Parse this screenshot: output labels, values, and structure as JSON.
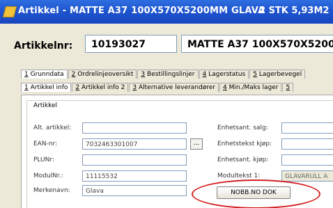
{
  "window": {
    "title": "Artikkel - MATTE A37 100X570X5200MM GLAVA",
    "title_right": "2 STK 5,93M2"
  },
  "header": {
    "article_label": "Artikkelnr:",
    "article_number": "10193027",
    "article_name": "MATTE A37 100X570X5200MM"
  },
  "tabs_primary": [
    {
      "num": "1",
      "label": "Grunndata"
    },
    {
      "num": "2",
      "label": "Ordrelinjeoversikt"
    },
    {
      "num": "3",
      "label": "Bestillingslinjer"
    },
    {
      "num": "4",
      "label": "Lagerstatus"
    },
    {
      "num": "5",
      "label": "Lagerbevegel"
    }
  ],
  "tabs_secondary": [
    {
      "num": "1",
      "label": "Artikkel info"
    },
    {
      "num": "2",
      "label": "Artikkel info 2"
    },
    {
      "num": "3",
      "label": "Alternative leverandører"
    },
    {
      "num": "4",
      "label": "Min./Maks lager"
    },
    {
      "num": "5",
      "label": ""
    }
  ],
  "group": {
    "title": "Artikkel"
  },
  "left_fields": [
    {
      "label": "Alt. artikkel:",
      "value": ""
    },
    {
      "label": "EAN-nr:",
      "value": "7032463301007"
    },
    {
      "label": "PLUNr:",
      "value": ""
    },
    {
      "label": "ModulNr.:",
      "value": "11115532"
    },
    {
      "label": "Merkenavn:",
      "value": "Glava"
    }
  ],
  "right_fields": [
    {
      "label": "Enhetsant. salg:",
      "value": ""
    },
    {
      "label": "Enhetstekst kjøp:",
      "value": ""
    },
    {
      "label": "Enhetsant. kjøp:",
      "value": ""
    },
    {
      "label": "Modultekst 1:",
      "value": "GLAVARULL A"
    }
  ],
  "buttons": {
    "ellipsis": "...",
    "nobb": "NOBB.NO DOK"
  },
  "colors": {
    "titlebar": "#1f55cf",
    "annotation_circle": "#d21f1f"
  }
}
